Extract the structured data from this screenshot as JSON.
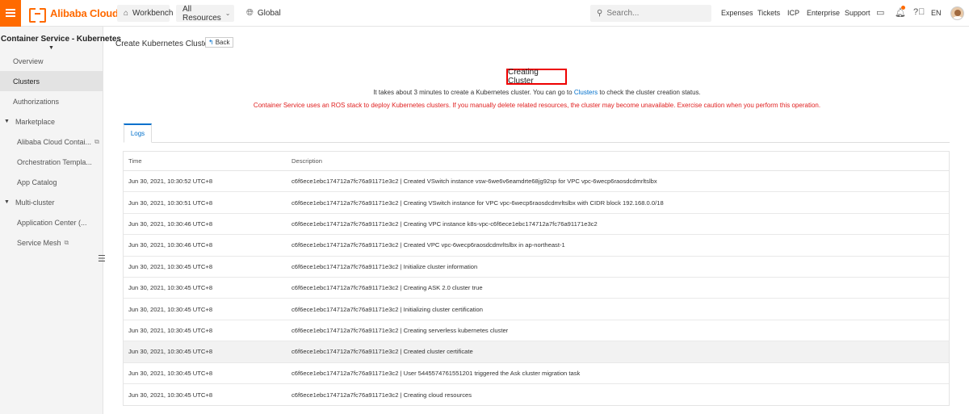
{
  "topbar": {
    "brand": "Alibaba Cloud",
    "workbench": "Workbench",
    "all_resources": "All Resources",
    "global": "Global",
    "search_placeholder": "Search...",
    "nav": [
      "Expenses",
      "Tickets",
      "ICP",
      "Enterprise",
      "Support"
    ],
    "language": "EN",
    "icons": [
      "menu-icon",
      "home-icon",
      "chevron-down-icon",
      "globe-icon",
      "search-icon",
      "terminal-icon",
      "bell-icon",
      "help-icon",
      "avatar"
    ]
  },
  "sidebar": {
    "title": "Container Service - Kubernetes",
    "items": [
      {
        "label": "Overview"
      },
      {
        "label": "Clusters"
      },
      {
        "label": "Authorizations"
      },
      {
        "label": "Marketplace"
      },
      {
        "label": "Alibaba Cloud Contai..."
      },
      {
        "label": "Orchestration Templa..."
      },
      {
        "label": "App Catalog"
      },
      {
        "label": "Multi-cluster"
      },
      {
        "label": "Application Center (..."
      },
      {
        "label": "Service Mesh"
      }
    ]
  },
  "page": {
    "title": "Create Kubernetes Cluster",
    "back": "Back",
    "status_title": "Creating Cluster",
    "info_before": "It takes about 3 minutes to create a Kubernetes cluster. You can go to ",
    "info_link": "Clusters",
    "info_after": " to check the cluster creation status.",
    "warning": "Container Service uses an ROS stack to deploy Kubernetes clusters. If you manually delete related resources, the cluster may become unavailable. Exercise caution when you perform this operation.",
    "tab": "Logs"
  },
  "logs": {
    "headers": {
      "time": "Time",
      "description": "Description"
    },
    "rows": [
      {
        "time": "Jun 30, 2021, 10:30:52 UTC+8",
        "description": "c6f6ece1ebc174712a7fc76a91171e3c2 | Created VSwitch instance vsw-6we6v6eamdrte68jg92sp for VPC vpc-6wecp6raosdcdmrltslbx"
      },
      {
        "time": "Jun 30, 2021, 10:30:51 UTC+8",
        "description": "c6f6ece1ebc174712a7fc76a91171e3c2 | Creating VSwitch instance for VPC vpc-6wecp6raosdcdmrltslbx with CIDR block 192.168.0.0/18"
      },
      {
        "time": "Jun 30, 2021, 10:30:46 UTC+8",
        "description": "c6f6ece1ebc174712a7fc76a91171e3c2 | Creating VPC instance k8s-vpc-c6f6ece1ebc174712a7fc76a91171e3c2"
      },
      {
        "time": "Jun 30, 2021, 10:30:46 UTC+8",
        "description": "c6f6ece1ebc174712a7fc76a91171e3c2 | Created VPC vpc-6wecp6raosdcdmrltslbx in ap-northeast-1"
      },
      {
        "time": "Jun 30, 2021, 10:30:45 UTC+8",
        "description": "c6f6ece1ebc174712a7fc76a91171e3c2 | Initialize cluster information"
      },
      {
        "time": "Jun 30, 2021, 10:30:45 UTC+8",
        "description": "c6f6ece1ebc174712a7fc76a91171e3c2 | Creating ASK 2.0 cluster true"
      },
      {
        "time": "Jun 30, 2021, 10:30:45 UTC+8",
        "description": "c6f6ece1ebc174712a7fc76a91171e3c2 | Initializing cluster certification"
      },
      {
        "time": "Jun 30, 2021, 10:30:45 UTC+8",
        "description": "c6f6ece1ebc174712a7fc76a91171e3c2 | Creating serverless kubernetes cluster"
      },
      {
        "time": "Jun 30, 2021, 10:30:45 UTC+8",
        "description": "c6f6ece1ebc174712a7fc76a91171e3c2 | Created cluster certificate"
      },
      {
        "time": "Jun 30, 2021, 10:30:45 UTC+8",
        "description": "c6f6ece1ebc174712a7fc76a91171e3c2 | User 5445574761551201 triggered the Ask cluster migration task"
      },
      {
        "time": "Jun 30, 2021, 10:30:45 UTC+8",
        "description": "c6f6ece1ebc174712a7fc76a91171e3c2 | Creating cloud resources"
      }
    ]
  },
  "colors": {
    "accent": "#ff6a00",
    "link": "#0070cc",
    "warning": "#e02020",
    "highlight_box": "#e00000"
  }
}
